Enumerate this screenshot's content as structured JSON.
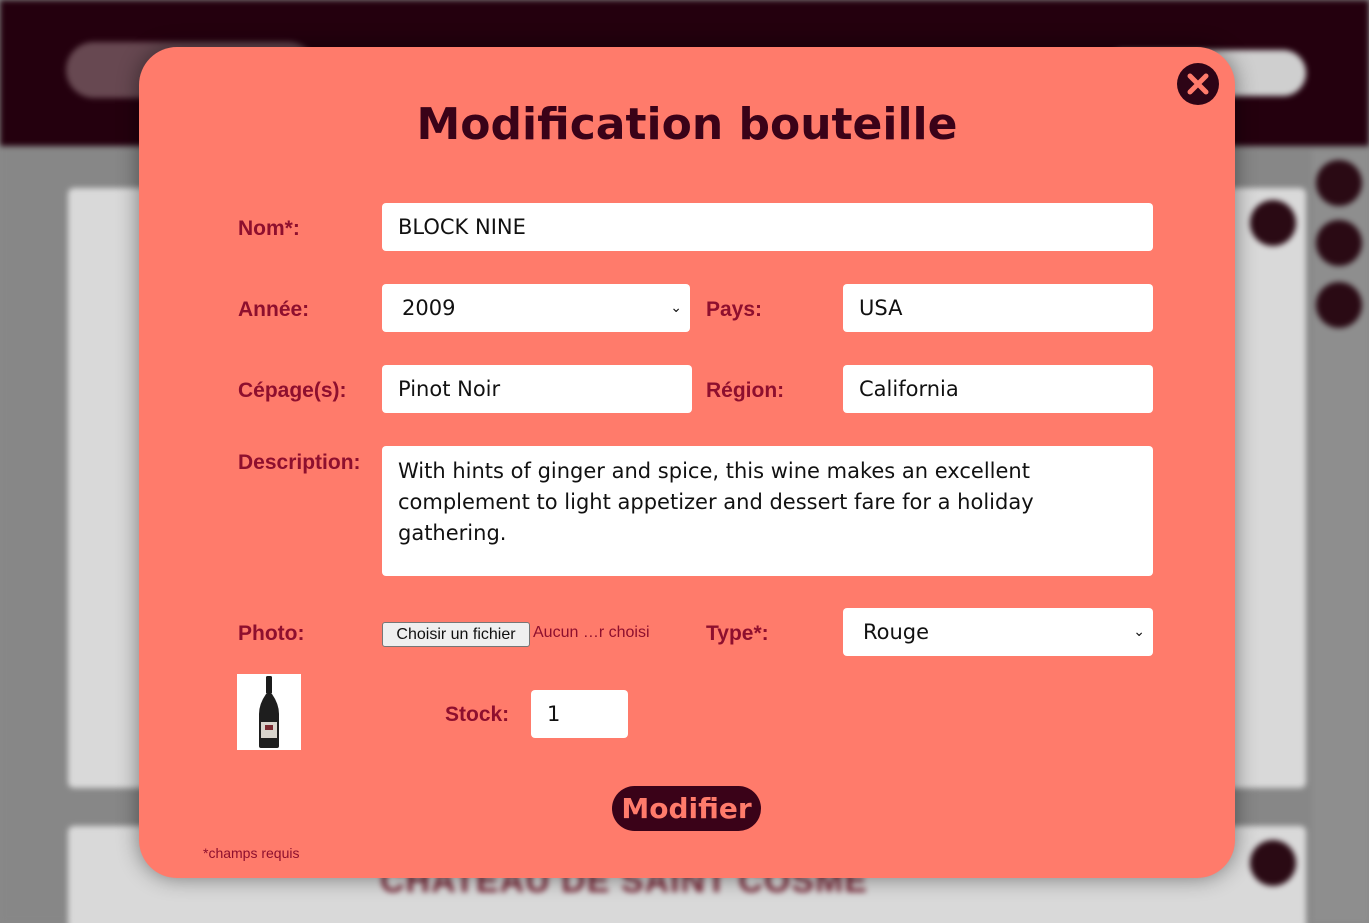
{
  "modal": {
    "title": "Modification bouteille",
    "close_icon": "close-circle-icon",
    "nom": {
      "label": "Nom*:",
      "value": "BLOCK NINE"
    },
    "annee": {
      "label": "Année:",
      "value": "2009"
    },
    "pays": {
      "label": "Pays:",
      "value": "USA"
    },
    "cepage": {
      "label": "Cépage(s):",
      "value": "Pinot Noir"
    },
    "region": {
      "label": "Région:",
      "value": "California"
    },
    "description": {
      "label": "Description:",
      "value": "With hints of ginger and spice, this wine makes an excellent complement to light appetizer and dessert fare for a holiday gathering."
    },
    "photo": {
      "label": "Photo:",
      "button": "Choisir un fichier",
      "status": "Aucun …r choisi"
    },
    "type": {
      "label": "Type*:",
      "value": "Rouge"
    },
    "stock": {
      "label": "Stock:",
      "value": "1"
    },
    "submit": "Modifier",
    "required_note": "*champs requis"
  },
  "background": {
    "card_title": "CHATEAU DE SAINT COSME"
  },
  "colors": {
    "modal_bg": "#ff7b6b",
    "label": "#8e0f2e",
    "title": "#3a0218",
    "header": "#24000e"
  }
}
